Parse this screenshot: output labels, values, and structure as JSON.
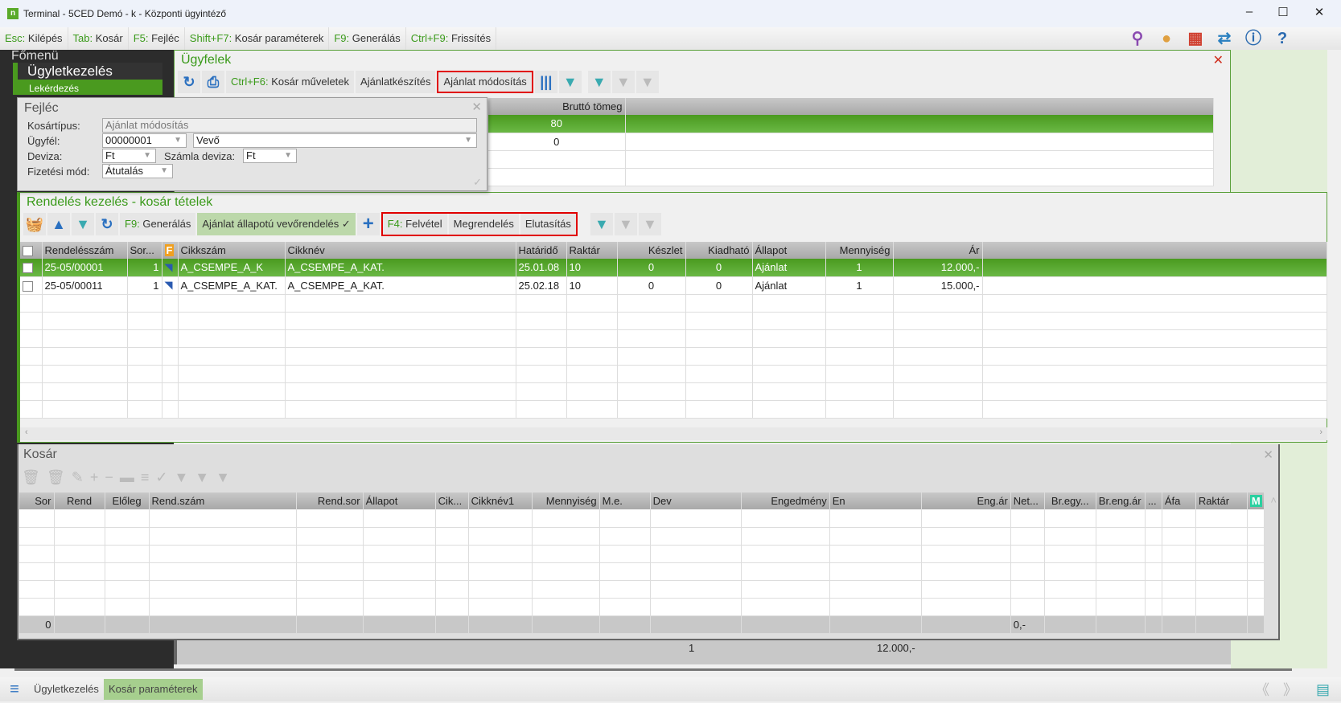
{
  "window": {
    "title": "Terminal - 5CED Demó - k - Központi ügyintéző",
    "logo": "n",
    "minimize": "‒",
    "maximize": "☐",
    "close": "✕"
  },
  "shortcuts": [
    {
      "k": "Esc:",
      "l": " Kilépés"
    },
    {
      "k": "Tab:",
      "l": " Kosár"
    },
    {
      "k": "F5:",
      "l": " Fejléc"
    },
    {
      "k": "Shift+F7:",
      "l": " Kosár paraméterek"
    },
    {
      "k": "F9:",
      "l": " Generálás"
    },
    {
      "k": "Ctrl+F9:",
      "l": " Frissítés"
    }
  ],
  "top_icons": [
    "search-icon",
    "user-icon",
    "tiles-icon",
    "exchange-icon",
    "info-icon",
    "help-icon"
  ],
  "sidebar": {
    "header": "Főmenü",
    "item": "Ügyletkezelés",
    "sub": "Lekérdezés"
  },
  "ugyfelek": {
    "title": "Ügyfelek",
    "close": "✕",
    "shortcut_k": "Ctrl+F6:",
    "shortcut_l": " Kosár műveletek",
    "btn_offer": "Ajánlatkészítés",
    "btn_modify": "Ajánlat módosítás",
    "col_gross": "Bruttó tömeg",
    "rows": [
      "80",
      "0",
      "",
      ""
    ]
  },
  "fejlec": {
    "title": "Fejléc",
    "close": "✕",
    "kosartipus_label": "Kosártípus:",
    "kosartipus": "Ajánlat módosítás",
    "ugyfel_label": "Ügyfél:",
    "ugyfel_code": "00000001",
    "ugyfel_name": "Vevő",
    "deviza_label": "Deviza:",
    "deviza": "Ft",
    "szamla_deviza_label": "Számla deviza:",
    "szamla_deviza": "Ft",
    "fizetesi_label": "Fizetési mód:",
    "fizetesi": "Átutalás"
  },
  "rendeles": {
    "title": "Rendelés kezelés - kosár tételek",
    "gen_k": "F9:",
    "gen_l": " Generálás",
    "status_btn": "Ajánlat állapotú vevőrendelés ✓",
    "felvetel_k": "F4:",
    "felvetel_l": " Felvétel",
    "megrendeles": "Megrendelés",
    "elutasitas": "Elutasítás",
    "columns": [
      "Rendelésszám",
      "Sor...",
      "F",
      "Cikkszám",
      "Cikknév",
      "Határidő",
      "Raktár",
      "Készlet",
      "Kiadható",
      "Állapot",
      "Mennyiség",
      "Ár"
    ],
    "rows": [
      [
        "25-05/00001",
        "1",
        "",
        "A_CSEMPE_A_K",
        "A_CSEMPE_A_KAT.",
        "25.01.08",
        "10",
        "0",
        "0",
        "Ajánlat",
        "1",
        "12.000,-"
      ],
      [
        "25-05/00011",
        "1",
        "",
        "A_CSEMPE_A_KAT.",
        "A_CSEMPE_A_KAT.",
        "25.02.18",
        "10",
        "0",
        "0",
        "Ajánlat",
        "1",
        "15.000,-"
      ]
    ]
  },
  "kosar": {
    "title": "Kosár",
    "close": "✕",
    "columns": [
      "Sor",
      "Rend",
      "Előleg",
      "Rend.szám",
      "Rend.sor",
      "Állapot",
      "Cik...",
      "Cikknév1",
      "Mennyiség",
      "M.e.",
      "Dev",
      "Engedmény",
      "En",
      "Eng.ár",
      "Net...",
      "Br.egy...",
      "Br.eng.ár",
      "...",
      "Áfa",
      "Raktár",
      "M"
    ],
    "footer_count": "0",
    "footer_net": "0,-"
  },
  "behind_totals": {
    "qty": "1",
    "sum": "12.000,-"
  },
  "taskbar": {
    "items": [
      "Ügyletkezelés",
      "Kosár paraméterek"
    ],
    "prev": "《",
    "next": "》"
  },
  "colors": {
    "accent": "#4a9a1f",
    "highlight": "#e00000"
  }
}
